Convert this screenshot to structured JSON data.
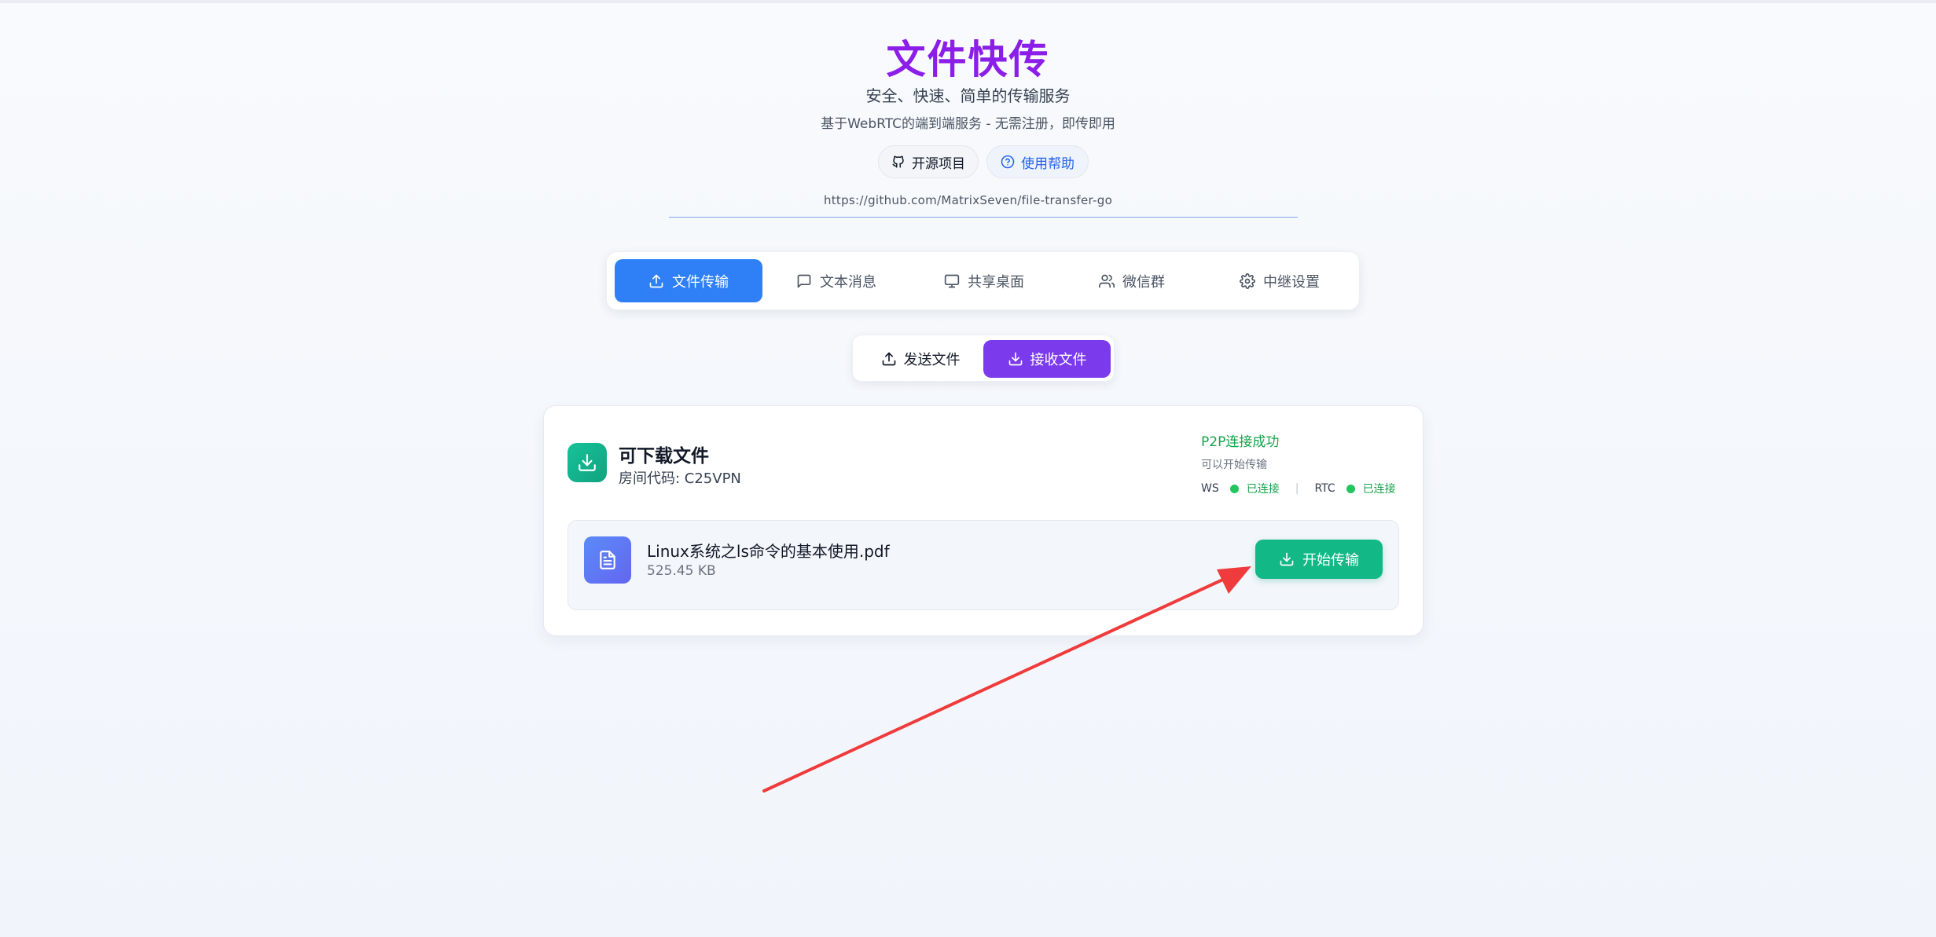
{
  "header": {
    "title": "文件快传",
    "subtitle": "安全、快速、简单的传输服务",
    "tagline": "基于WebRTC的端到端服务 - 无需注册，即传即用",
    "repo_button": "开源项目",
    "help_button": "使用帮助",
    "repo_url": "https://github.com/MatrixSeven/file-transfer-go"
  },
  "main_tabs": [
    {
      "label": "文件传输",
      "icon": "upload-icon",
      "active": true
    },
    {
      "label": "文本消息",
      "icon": "chat-icon",
      "active": false
    },
    {
      "label": "共享桌面",
      "icon": "monitor-icon",
      "active": false
    },
    {
      "label": "微信群",
      "icon": "users-icon",
      "active": false
    },
    {
      "label": "中继设置",
      "icon": "gear-icon",
      "active": false
    }
  ],
  "sub_tabs": [
    {
      "label": "发送文件",
      "icon": "upload-icon",
      "active": false
    },
    {
      "label": "接收文件",
      "icon": "download-icon",
      "active": true
    }
  ],
  "card": {
    "title": "可下载文件",
    "room_code": "房间代码: C25VPN",
    "status": {
      "p2p": "P2P连接成功",
      "hint": "可以开始传输",
      "ws_label": "WS",
      "ws_state": "已连接",
      "rtc_label": "RTC",
      "rtc_state": "已连接",
      "separator": "|"
    },
    "file": {
      "name": "Linux系统之ls命令的基本使用.pdf",
      "size": "525.45 KB",
      "icon": "document-icon"
    },
    "start_button": "开始传输"
  },
  "colors": {
    "title": "#8b1ee8",
    "active_tab": "#2f80f7",
    "active_subtab": "#7c3aed",
    "success": "#16a34a",
    "start_button": "#12b886",
    "annotation_arrow": "#ef3b3b"
  }
}
